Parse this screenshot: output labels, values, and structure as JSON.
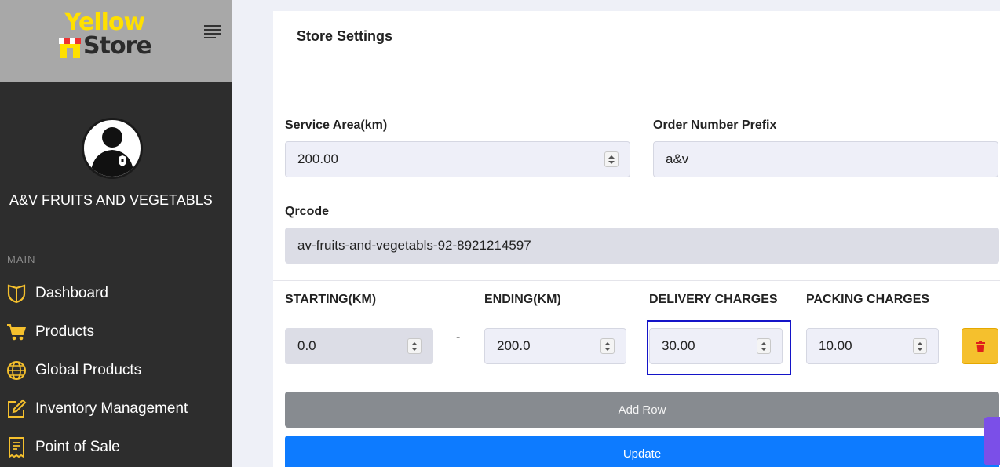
{
  "brand": {
    "logo_top": "Yellow",
    "logo_bottom": "Store",
    "logo_colors": {
      "yellow": "#ffe000",
      "dark": "#2b2b2b"
    }
  },
  "sidebar": {
    "store_name": "A&V FRUITS AND VEGETABLS",
    "section_label": "MAIN",
    "items": [
      {
        "label": "Dashboard",
        "icon": "shield-icon"
      },
      {
        "label": "Products",
        "icon": "cart-icon"
      },
      {
        "label": "Global Products",
        "icon": "globe-icon"
      },
      {
        "label": "Inventory Management",
        "icon": "edit-icon"
      },
      {
        "label": "Point of Sale",
        "icon": "receipt-icon"
      }
    ],
    "icon_color": "#f5c02d"
  },
  "page": {
    "title": "Store Settings",
    "service_area": {
      "label": "Service Area(km)",
      "value": "200.00"
    },
    "order_prefix": {
      "label": "Order Number Prefix",
      "value": "a&v"
    },
    "qrcode": {
      "label": "Qrcode",
      "value": "av-fruits-and-vegetabls-92-8921214597"
    },
    "table": {
      "headers": [
        "STARTING(KM)",
        "ENDING(KM)",
        "DELIVERY CHARGES",
        "PACKING CHARGES"
      ],
      "row": {
        "starting": "0.0",
        "separator": "-",
        "ending": "200.0",
        "delivery": "30.00",
        "packing": "10.00"
      }
    },
    "add_row_label": "Add Row",
    "update_label": "Update",
    "colors": {
      "update": "#0d7bff",
      "add_row": "#878b90",
      "delete": "#f5c02d"
    }
  }
}
